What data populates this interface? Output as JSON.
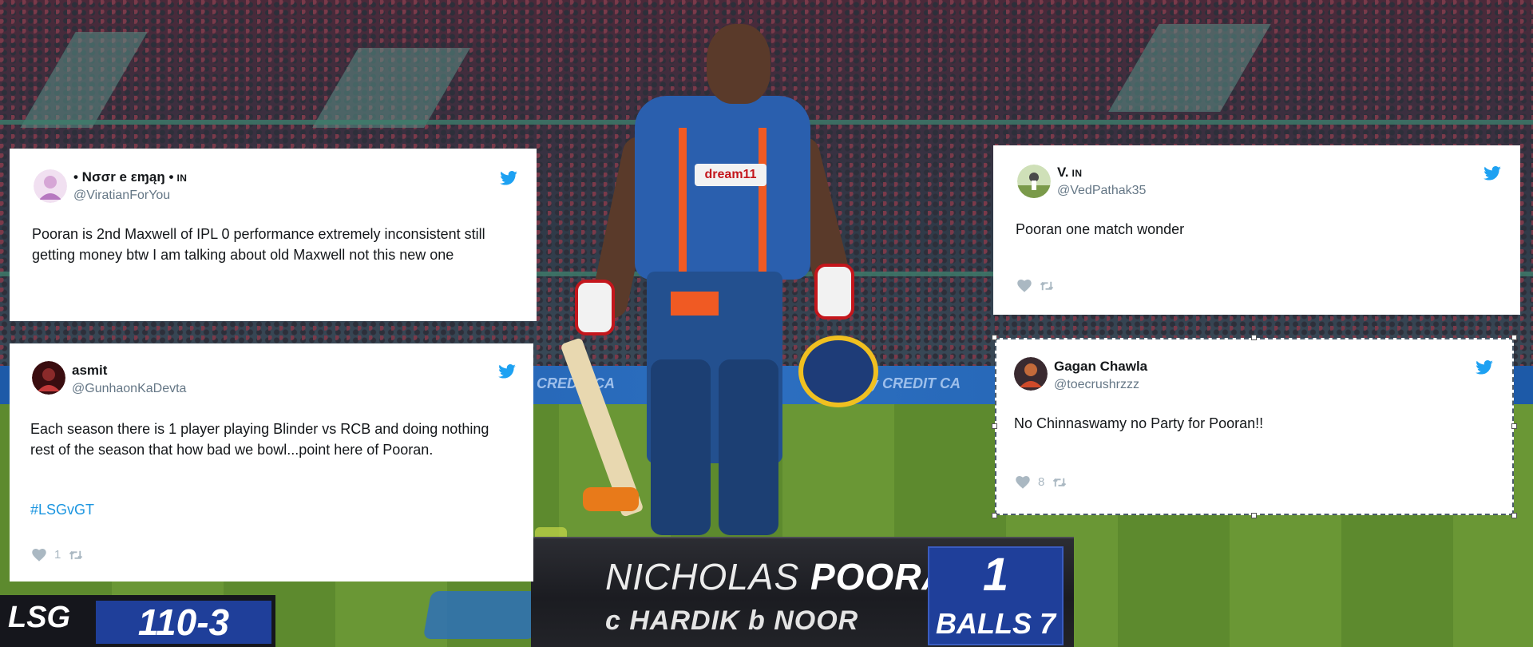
{
  "scoreboard": {
    "team": "LSG",
    "score": "110-3",
    "player_first": "NICHOLAS",
    "player_last": "POORAN",
    "dismissal": "c HARDIK  b NOOR",
    "runs": "1",
    "balls": "BALLS 7"
  },
  "tweets": [
    {
      "display_name": "• Nσσr e εɱąŋ •",
      "country": "IN",
      "username": "@ViratianForYou",
      "text": "Pooran is 2nd Maxwell of IPL 0 performance extremely inconsistent still getting money btw I am talking about old Maxwell not this new one",
      "hashtag": "",
      "likes": "",
      "avatar_color": "#e8c6e8"
    },
    {
      "display_name": "asmit",
      "country": "",
      "username": "@GunhaonKaDevta",
      "text": "Each season there is 1 player playing Blinder vs RCB and doing nothing rest of the season that how bad we bowl...point here of Pooran.",
      "hashtag": "#LSGvGT",
      "likes": "1",
      "avatar_color": "#6a1a1a"
    },
    {
      "display_name": "V.",
      "country": "IN",
      "username": "@VedPathak35",
      "text": "Pooran one match wonder",
      "hashtag": "",
      "likes": "",
      "avatar_color": "#8fb06a"
    },
    {
      "display_name": "Gagan Chawla",
      "country": "",
      "username": "@toecrushrzzz",
      "text": "No Chinnaswamy no Party for Pooran!!",
      "hashtag": "",
      "likes": "8",
      "avatar_color": "#9a3a2a"
    }
  ],
  "colors": {
    "twitter_blue": "#1da1f2",
    "action_gray": "#aab8c2",
    "hashtag_blue": "#1b95e0"
  },
  "icons": [
    "twitter-bird-icon",
    "heart-icon",
    "retweet-icon"
  ]
}
